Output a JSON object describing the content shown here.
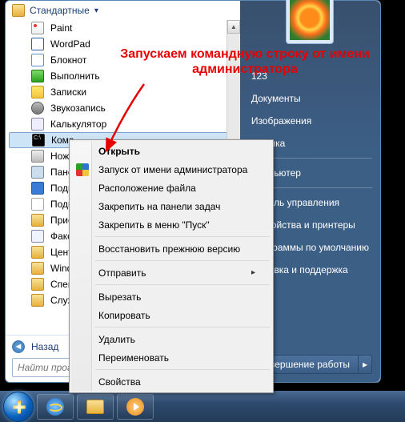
{
  "annotation": {
    "line1": "Запускаем командную строку от имени",
    "line2": "администратора"
  },
  "start_menu": {
    "header": "Стандартные",
    "items": [
      {
        "label": "Paint",
        "icon": "paint"
      },
      {
        "label": "WordPad",
        "icon": "wordpad"
      },
      {
        "label": "Блокнот",
        "icon": "note"
      },
      {
        "label": "Выполнить",
        "icon": "run"
      },
      {
        "label": "Записки",
        "icon": "sticky"
      },
      {
        "label": "Звукозапись",
        "icon": "snd"
      },
      {
        "label": "Калькулятор",
        "icon": "calc"
      },
      {
        "label": "Командная строка",
        "icon": "cmd",
        "selected": true,
        "truncated": "Кома"
      },
      {
        "label": "Ножницы",
        "icon": "scis",
        "truncated": "Ножн"
      },
      {
        "label": "Панель математического ввода",
        "icon": "tablet",
        "truncated": "Пане"
      },
      {
        "label": "Подключение к удалённому рабочему столу",
        "icon": "rdp",
        "truncated": "Подк"
      },
      {
        "label": "Подключить к проектору",
        "icon": "proj",
        "truncated": "Подк"
      },
      {
        "label": "Приступая к работе",
        "icon": "folder",
        "truncated": "Прис"
      },
      {
        "label": "Факсы и сканирование Windows",
        "icon": "fax",
        "truncated": "Факс"
      },
      {
        "label": "Центр синхронизации",
        "icon": "folder",
        "truncated": "Центр"
      },
      {
        "label": "Windows PowerShell",
        "icon": "folder",
        "truncated": "Wind"
      },
      {
        "label": "Специальные возможности",
        "icon": "folder",
        "truncated": "Спец"
      },
      {
        "label": "Служебные",
        "icon": "folder",
        "truncated": "Служ"
      }
    ],
    "back": "Назад",
    "search_placeholder": "Найти программы и файлы"
  },
  "right_panel": {
    "user": "123",
    "items_top": [
      "Документы",
      "Изображения",
      "Музыка"
    ],
    "items_mid": [
      "Компьютер"
    ],
    "items_ctl": [
      "Панель управления",
      "Устройства и принтеры",
      "Программы по умолчанию",
      "Справка и поддержка"
    ],
    "shutdown": "Завершение работы"
  },
  "context_menu": {
    "items": [
      {
        "label": "Открыть",
        "default": true
      },
      {
        "label": "Запуск от имени администратора",
        "shield": true
      },
      {
        "label": "Расположение файла"
      },
      {
        "label": "Закрепить на панели задач"
      },
      {
        "label": "Закрепить в меню \"Пуск\""
      },
      {
        "sep": true
      },
      {
        "label": "Восстановить прежнюю версию"
      },
      {
        "sep": true
      },
      {
        "label": "Отправить",
        "submenu": true
      },
      {
        "sep": true
      },
      {
        "label": "Вырезать"
      },
      {
        "label": "Копировать"
      },
      {
        "sep": true
      },
      {
        "label": "Удалить"
      },
      {
        "label": "Переименовать"
      },
      {
        "sep": true
      },
      {
        "label": "Свойства"
      }
    ]
  }
}
